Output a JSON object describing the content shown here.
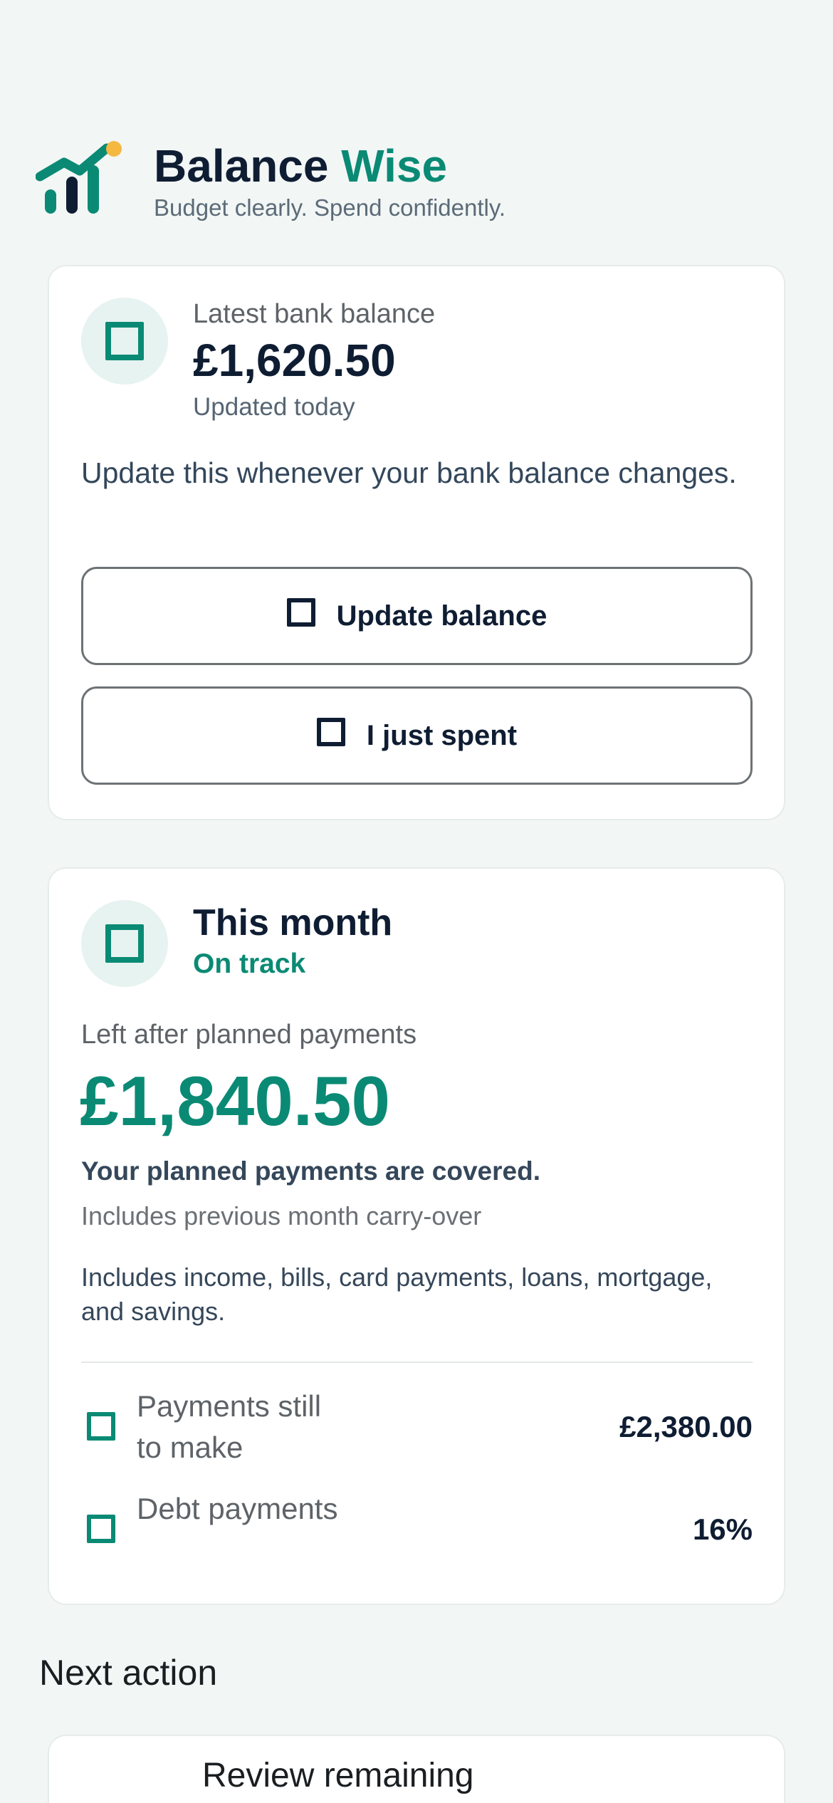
{
  "brand": {
    "title_main": "Balance",
    "title_accent": "Wise",
    "tagline": "Budget clearly. Spend confidently.",
    "colors": {
      "primary": "#0a8a74",
      "dark": "#0f1d33",
      "dot": "#f5b942"
    },
    "logo_icon": "growth-chart-logo"
  },
  "balance_card": {
    "icon": "square-icon",
    "label": "Latest bank balance",
    "amount": "£1,620.50",
    "updated": "Updated today",
    "description": "Update this whenever your bank balance changes.",
    "buttons": {
      "update_label": "Update balance",
      "spent_label": "I just spent"
    }
  },
  "month_card": {
    "icon": "square-icon",
    "title": "This month",
    "status": "On track",
    "left_label": "Left after planned payments",
    "left_amount": "£1,840.50",
    "covered": "Your planned payments are covered.",
    "carryover": "Includes previous month carry-over",
    "includes": "Includes income, bills, card payments, loans, mortgage, and savings.",
    "stats": [
      {
        "label": "Payments still to make",
        "value": "£2,380.00"
      },
      {
        "label": "Debt payments",
        "value": "16%"
      }
    ]
  },
  "next_action": {
    "heading": "Next action",
    "item_text": "Review remaining"
  }
}
